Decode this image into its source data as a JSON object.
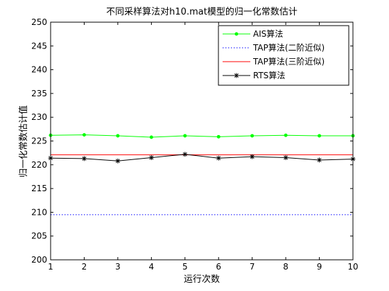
{
  "chart_data": {
    "type": "line",
    "title": "不同采样算法对h10.mat模型的归一化常数估计",
    "xlabel": "运行次数",
    "ylabel": "归一化常数估计值",
    "xlim": [
      1,
      10
    ],
    "ylim": [
      200,
      250
    ],
    "x": [
      1,
      2,
      3,
      4,
      5,
      6,
      7,
      8,
      9,
      10
    ],
    "xticks": [
      "1",
      "2",
      "3",
      "4",
      "5",
      "6",
      "7",
      "8",
      "9",
      "10"
    ],
    "yticks": [
      "200",
      "205",
      "210",
      "215",
      "220",
      "225",
      "230",
      "235",
      "240",
      "245",
      "250"
    ],
    "grid": false,
    "legend_position": "top-right",
    "series": [
      {
        "name": "AIS算法",
        "color": "#00ff00",
        "line_style": "solid",
        "marker": "dot",
        "values": [
          226.2,
          226.3,
          226.1,
          225.8,
          226.1,
          225.9,
          226.1,
          226.2,
          226.1,
          226.1
        ]
      },
      {
        "name": "TAP算法(二阶近似)",
        "color": "#0000ff",
        "line_style": "dotted",
        "marker": "none",
        "values": [
          209.5,
          209.5,
          209.5,
          209.5,
          209.5,
          209.5,
          209.5,
          209.5,
          209.5,
          209.5
        ]
      },
      {
        "name": "TAP算法(三阶近似)",
        "color": "#ff0000",
        "line_style": "solid",
        "marker": "none",
        "values": [
          222.1,
          222.1,
          222.1,
          222.1,
          222.1,
          222.1,
          222.1,
          222.1,
          222.1,
          222.1
        ]
      },
      {
        "name": "RTS算法",
        "color": "#000000",
        "line_style": "solid",
        "marker": "star",
        "values": [
          221.4,
          221.3,
          220.8,
          221.5,
          222.2,
          221.4,
          221.7,
          221.5,
          221.0,
          221.2
        ]
      }
    ]
  }
}
